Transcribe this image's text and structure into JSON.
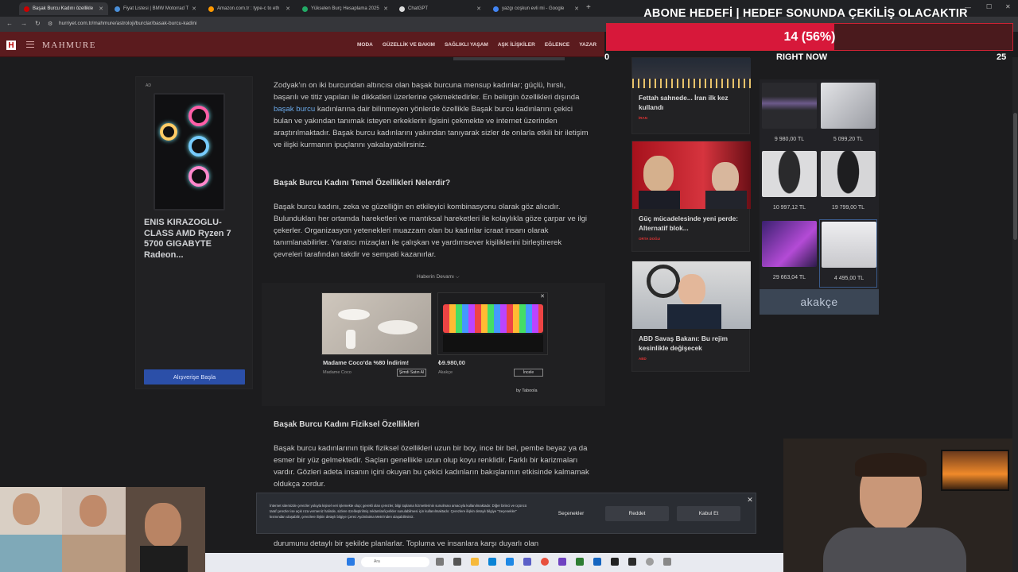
{
  "browser": {
    "tabs": [
      {
        "label": "Başak Burcu Kadını özellikle",
        "active": true
      },
      {
        "label": "Fiyat Listesi | BMW Motorrad T"
      },
      {
        "label": "Amazon.com.tr : type-c to eth"
      },
      {
        "label": "Yükselen Burç Hesaplama 2025"
      },
      {
        "label": "ChatGPT"
      },
      {
        "label": "yazgı coşkun evli mi - Google"
      }
    ],
    "url": "hurriyet.com.tr/mahmure/astroloji/burclar/basak-burcu-kadini"
  },
  "site": {
    "brand": "MAHMURE",
    "logo_letter": "H",
    "nav": [
      "MODA",
      "GÜZELLİK VE BAKIM",
      "SAĞLIKLI YAŞAM",
      "AŞK İLİŞKİLER",
      "EĞLENCE",
      "YAZAR"
    ]
  },
  "left_ad": {
    "label": "AD",
    "title": "ENIS KIRAZOGLU-CLASS AMD Ryzen 7 5700 GIGABYTE Radeon...",
    "button": "Alışverişe Başla"
  },
  "article": {
    "intro_before_link": "Zodyak'ın on iki burcundan altıncısı olan başak burcuna mensup kadınlar; güçlü, hırslı, başarılı ve titiz yapıları ile dikkatleri üzerlerine çekmektedirler. En belirgin özellikleri dışında ",
    "intro_link": "başak burcu",
    "intro_after_link": " kadınlarına dair bilinmeyen yönlerde özellikle Başak burcu kadınlarını çekici bulan ve yakından tanımak isteyen erkeklerin ilgisini çekmekte ve internet üzerinden araştırılmaktadır. Başak burcu kadınlarını yakından tanıyarak sizler de onlarla etkili bir iletişim ve ilişki kurmanın ipuçlarını yakalayabilirsiniz.",
    "heading1": "Başak Burcu Kadını Temel Özellikleri Nelerdir?",
    "para2": "Başak burcu kadını, zeka ve güzelliğin en etkileyici kombinasyonu olarak göz alıcıdır. Bulundukları her ortamda hareketleri ve mantıksal hareketleri ile kolaylıkla göze çarpar ve ilgi çekerler. Organizasyon yetenekleri muazzam olan bu kadınlar icraat insanı olarak tanımlanabilirler. Yaratıcı mizaçları ile çalışkan ve yardımsever kişiliklerini birleştirerek çevreleri tarafından takdir ve sempati kazanırlar.",
    "read_more": "Haberin Devamı ⌵",
    "heading2": "Başak Burcu Kadını Fiziksel Özellikleri",
    "para3": "Başak burcu kadınlarının tipik fiziksel özellikleri uzun bir boy, ince bir bel, pembe beyaz ya da esmer bir yüz gelmektedir. Saçları genellikle uzun olup koyu renklidir. Farklı bir karizmaları vardır. Gözleri adeta insanın içini okuyan bu çekici kadınların bakışlarının etkisinde kalmamak oldukça zordur.",
    "para4": "durumunu detaylı bir şekilde planlarlar. Topluma ve insanlara karşı duyarlı olan"
  },
  "taboola": {
    "card1": {
      "title": "Madame Coco'da %80 İndirim!",
      "source": "Madame Coco",
      "button": "Şimdi Satın Al"
    },
    "card2": {
      "price": "₺9.980,00",
      "source": "Akakçe",
      "button": "İncele"
    },
    "by": "by Taboola"
  },
  "news": [
    {
      "title": "Fettah sahnede... İran ilk kez kullandı",
      "tag": "İRAN"
    },
    {
      "title": "Güç mücadelesinde yeni perde: Alternatif blok...",
      "tag": "ORTA DOĞU"
    },
    {
      "title": "ABD Savaş Bakanı: Bu rejim kesinlikle değişecek",
      "tag": "ABD"
    }
  ],
  "products": [
    {
      "price": "9 980,00 TL",
      "color": "#5a4a6a"
    },
    {
      "price": "5 099,20 TL",
      "color": "#b9bcc2"
    },
    {
      "price": "10 997,12 TL",
      "color": "#d7d7d9"
    },
    {
      "price": "19 799,00 TL",
      "color": "#d4d4d6"
    },
    {
      "price": "29 663,04 TL",
      "color": "#7a3aa6"
    },
    {
      "price": "4 495,00 TL",
      "color": "#e4e4e6"
    }
  ],
  "akakce_logo": "akakçe",
  "stream_goal": {
    "title": "ABONE HEDEFİ | HEDEF SONUNDA ÇEKİLİŞ OLACAKTIR",
    "progress_text": "14 (56%)",
    "progress": 0.56,
    "min": "0",
    "max": "25",
    "now_label": "RIGHT NOW"
  },
  "cookie": {
    "text": "İnternet sitemizde çerezler yoluyla kişisel veri işlemekte olup; gerekli olan çerezler, bilgi toplama hizmetlerinin sunulması amacıyla kullanılmaktadır. Diğer birinci ve üçüncü taraf çerezler ise açık rıza vermeniz halinde, sizlere özelleştirilmiş reklamlar/içerikler sunulabilmesi için kullanılmaktadır. Çerezlere ilişkin detaylı bilgiye \"Seçenekler\" kısmından ulaşabilir, çerezlere ilişkin detaylı bilgiye Çerez Aydınlatma Metni'nden ulaşabilirsiniz.",
    "options": "Seçenekler",
    "reject": "Reddet",
    "accept": "Kabul Et"
  },
  "taskbar": {
    "search_placeholder": "Ara"
  }
}
